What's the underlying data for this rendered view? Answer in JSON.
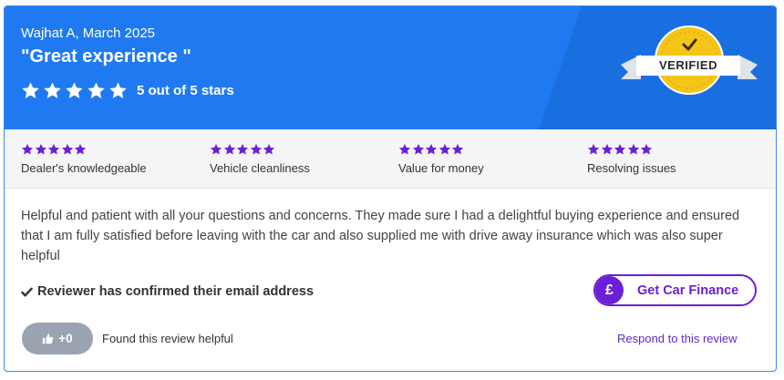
{
  "review": {
    "reviewer_line": "Wajhat A, March 2025",
    "title": "\"Great experience \"",
    "rating_value": 5,
    "rating_max": 5,
    "rating_text": "5 out of 5 stars",
    "badge_label": "VERIFIED"
  },
  "sub_ratings": [
    {
      "label": "Dealer's knowledgeable",
      "stars": 5
    },
    {
      "label": "Vehicle cleanliness",
      "stars": 5
    },
    {
      "label": "Value for money",
      "stars": 5
    },
    {
      "label": "Resolving issues",
      "stars": 5
    }
  ],
  "body": {
    "text": "Helpful and patient with all your questions and concerns. They made sure I had a delightful buying experience and ensured that I am fully satisfied before leaving with the car and also supplied me with drive away insurance which was also super helpful"
  },
  "confirmation": {
    "text": "Reviewer has confirmed their email address"
  },
  "finance": {
    "icon_glyph": "£",
    "label": "Get Car Finance"
  },
  "helpful": {
    "count_label": "+0",
    "text": "Found this review helpful"
  },
  "respond": {
    "label": "Respond to this review"
  },
  "colors": {
    "header_blue": "#1f7af2",
    "accent_purple": "#6b1fd6",
    "badge_gold": "#f5c518",
    "helpful_grey": "#9aa4b0"
  },
  "icons": {
    "star": "star-icon",
    "badge": "verified-badge-icon",
    "check": "check-icon",
    "thumb": "thumbs-up-icon",
    "pound": "pound-icon"
  }
}
